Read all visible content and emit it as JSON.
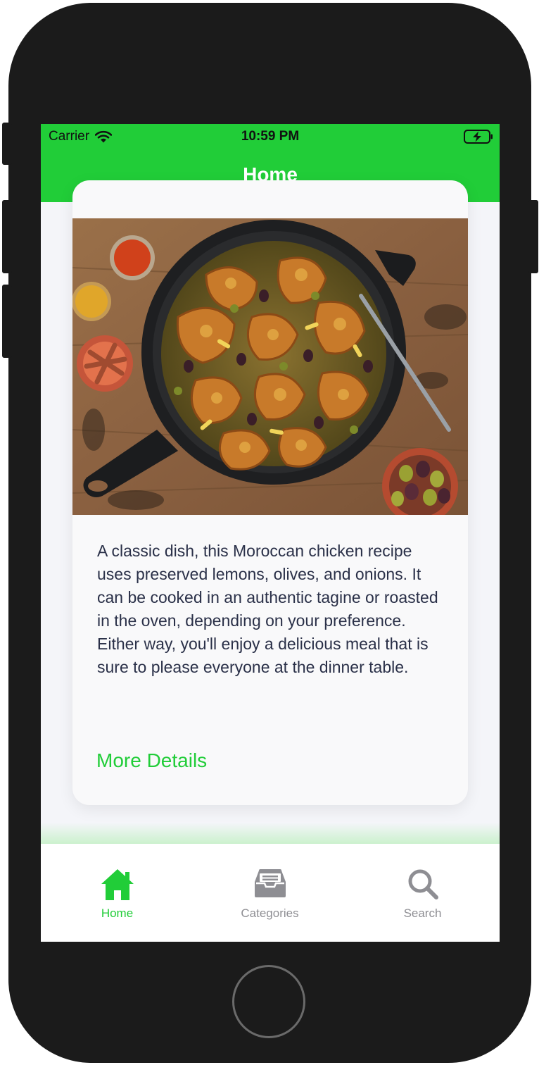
{
  "status_bar": {
    "carrier": "Carrier",
    "time": "10:59 PM"
  },
  "nav": {
    "title": "Home"
  },
  "card": {
    "image_alt": "Moroccan chicken with preserved lemons and olives in a cast-iron skillet",
    "description": "A classic dish, this Moroccan chicken recipe uses preserved lemons, olives, and onions. It can be cooked in an authentic tagine or roasted in the oven, depending on your preference. Either way, you'll enjoy a delicious meal that is sure to please everyone at the dinner table.",
    "more_details_label": "More Details"
  },
  "tab_bar": {
    "tabs": [
      {
        "label": "Home",
        "icon": "home-icon",
        "active": true
      },
      {
        "label": "Categories",
        "icon": "inbox-tray-icon",
        "active": false
      },
      {
        "label": "Search",
        "icon": "search-icon",
        "active": false
      }
    ]
  },
  "colors": {
    "accent": "#21cd38",
    "inactive": "#8e8e93",
    "text": "#2a3048",
    "background": "#f4f5f9"
  }
}
